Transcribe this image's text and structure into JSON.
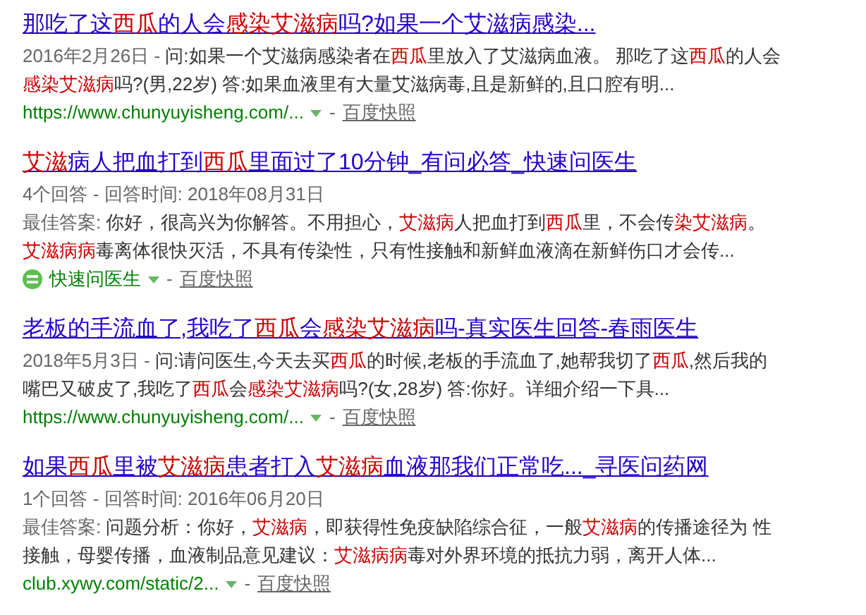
{
  "results": [
    {
      "title": [
        {
          "text": "那吃了这",
          "highlighted": false
        },
        {
          "text": "西瓜",
          "highlighted": true
        },
        {
          "text": "的人会",
          "highlighted": false
        },
        {
          "text": "感染艾滋病",
          "highlighted": true
        },
        {
          "text": "吗?如果一个艾滋病感染...",
          "highlighted": false
        }
      ],
      "lines": [
        {
          "lead": "2016年2月26日 - ",
          "parts": [
            {
              "text": "问:如果一个艾滋病感染者在",
              "highlighted": false
            },
            {
              "text": "西瓜",
              "highlighted": true
            },
            {
              "text": "里放入了艾滋病血液。 那吃了这",
              "highlighted": false
            },
            {
              "text": "西瓜",
              "highlighted": true
            },
            {
              "text": "的人会",
              "highlighted": false
            }
          ]
        },
        {
          "parts": [
            {
              "text": "感染艾滋病",
              "highlighted": true
            },
            {
              "text": "吗?(男,22岁) 答:如果血液里有大量艾滋病毒,且是新鲜的,且口腔有明...",
              "highlighted": false
            }
          ]
        }
      ],
      "source": {
        "kind": "url",
        "text": "https://www.chunyuyisheng.com/..."
      },
      "separator": "-",
      "snapshot": "百度快照"
    },
    {
      "title": [
        {
          "text": "艾滋",
          "highlighted": true
        },
        {
          "text": "病人把血打到",
          "highlighted": false
        },
        {
          "text": "西瓜",
          "highlighted": true
        },
        {
          "text": "里面过了10分钟_有问必答_快速问医生",
          "highlighted": false
        }
      ],
      "meta": "4个回答 - 回答时间: 2018年08月31日",
      "lines": [
        {
          "lead": "最佳答案: ",
          "parts": [
            {
              "text": "你好，很高兴为你解答。不用担心，",
              "highlighted": false
            },
            {
              "text": "艾滋病",
              "highlighted": true
            },
            {
              "text": "人把血打到",
              "highlighted": false
            },
            {
              "text": "西瓜",
              "highlighted": true
            },
            {
              "text": "里，不会传",
              "highlighted": false
            },
            {
              "text": "染艾滋病",
              "highlighted": true
            },
            {
              "text": "。",
              "highlighted": false
            }
          ]
        },
        {
          "parts": [
            {
              "text": "艾滋病病",
              "highlighted": true
            },
            {
              "text": "毒离体很快灭活，不具有传染性，只有性接触和新鲜血液滴在新鲜伤口才会传...",
              "highlighted": false
            }
          ]
        }
      ],
      "source": {
        "kind": "site",
        "text": "快速问医生"
      },
      "separator": "-",
      "snapshot": "百度快照"
    },
    {
      "title": [
        {
          "text": "老板的手流血了,我吃了",
          "highlighted": false
        },
        {
          "text": "西瓜",
          "highlighted": true
        },
        {
          "text": "会",
          "highlighted": false
        },
        {
          "text": "感染艾滋病",
          "highlighted": true
        },
        {
          "text": "吗-真实医生回答-春雨医生",
          "highlighted": false
        }
      ],
      "lines": [
        {
          "lead": "2018年5月3日 - ",
          "parts": [
            {
              "text": "问:请问医生,今天去买",
              "highlighted": false
            },
            {
              "text": "西瓜",
              "highlighted": true
            },
            {
              "text": "的时候,老板的手流血了,她帮我切了",
              "highlighted": false
            },
            {
              "text": "西瓜",
              "highlighted": true
            },
            {
              "text": ",然后我的",
              "highlighted": false
            }
          ]
        },
        {
          "parts": [
            {
              "text": "嘴巴又破皮了,我吃了",
              "highlighted": false
            },
            {
              "text": "西瓜",
              "highlighted": true
            },
            {
              "text": "会",
              "highlighted": false
            },
            {
              "text": "感染艾滋病",
              "highlighted": true
            },
            {
              "text": "吗?(女,28岁) 答:你好。详细介绍一下具...",
              "highlighted": false
            }
          ]
        }
      ],
      "source": {
        "kind": "url",
        "text": "https://www.chunyuyisheng.com/..."
      },
      "separator": "-",
      "snapshot": "百度快照"
    },
    {
      "title": [
        {
          "text": "如果",
          "highlighted": false
        },
        {
          "text": "西瓜",
          "highlighted": true
        },
        {
          "text": "里被",
          "highlighted": false
        },
        {
          "text": "艾滋病",
          "highlighted": true
        },
        {
          "text": "患者打入",
          "highlighted": false
        },
        {
          "text": "艾滋病",
          "highlighted": true
        },
        {
          "text": "血液那我们正常吃..._寻医问药网",
          "highlighted": false
        }
      ],
      "meta": "1个回答 - 回答时间: 2016年06月20日",
      "lines": [
        {
          "lead": "最佳答案: ",
          "parts": [
            {
              "text": "问题分析：你好，",
              "highlighted": false
            },
            {
              "text": "艾滋病",
              "highlighted": true
            },
            {
              "text": "，即获得性免疫缺陷综合征，一般",
              "highlighted": false
            },
            {
              "text": "艾滋病",
              "highlighted": true
            },
            {
              "text": "的传播途径为 性",
              "highlighted": false
            }
          ]
        },
        {
          "parts": [
            {
              "text": "接触，母婴传播，血液制品意见建议：",
              "highlighted": false
            },
            {
              "text": "艾滋病病",
              "highlighted": true
            },
            {
              "text": "毒对外界环境的抵抗力弱，离开人体...",
              "highlighted": false
            }
          ]
        }
      ],
      "source": {
        "kind": "url",
        "text": "club.xywy.com/static/2..."
      },
      "separator": "-",
      "snapshot": "百度快照"
    }
  ]
}
